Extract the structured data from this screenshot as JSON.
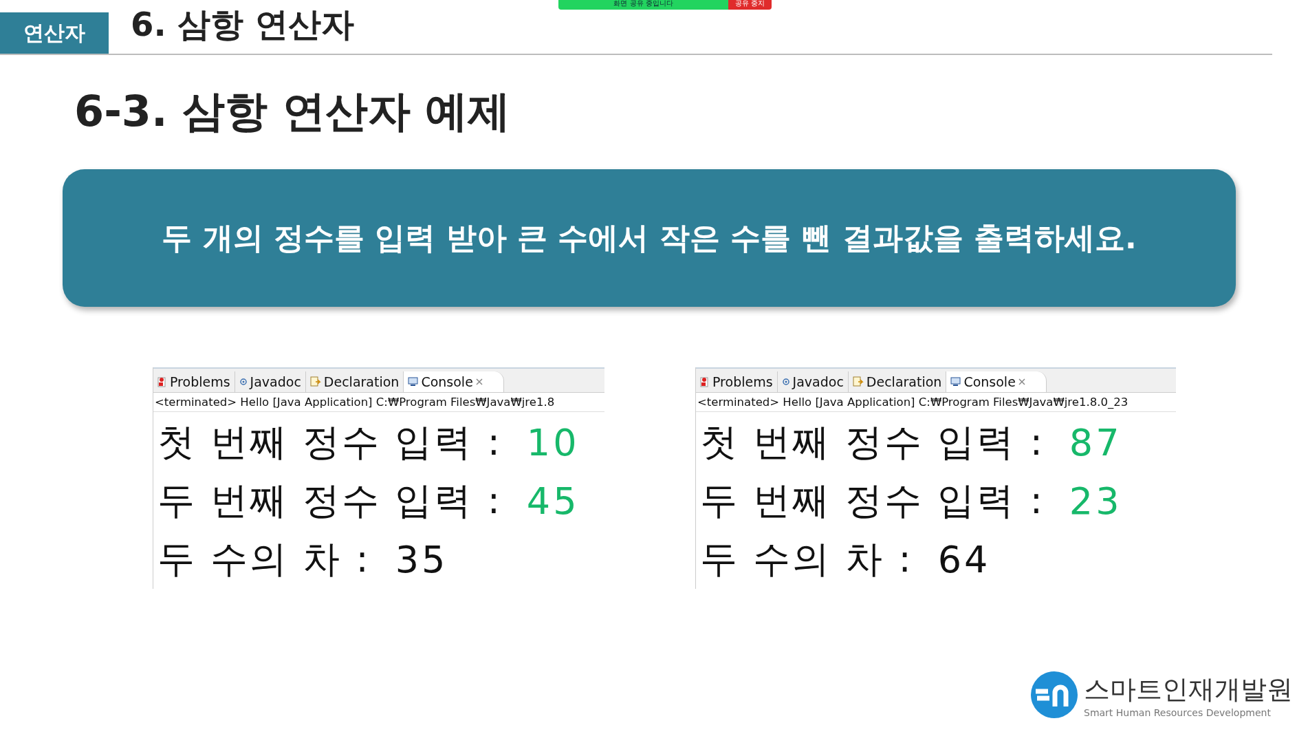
{
  "share_bar": {
    "status": "화면 공유 중입니다",
    "stop_button": "공유 중지"
  },
  "header": {
    "section_tag": "연산자",
    "title": "6. 삼항 연산자"
  },
  "subtitle": "6-3. 삼항 연산자 예제",
  "banner": "두 개의 정수를 입력 받아 큰 수에서 작은 수를 뺀 결과값을 출력하세요.",
  "consoles": [
    {
      "tabs": [
        {
          "label": "Problems",
          "selected": false
        },
        {
          "label": "Javadoc",
          "selected": false
        },
        {
          "label": "Declaration",
          "selected": false
        },
        {
          "label": "Console",
          "selected": true
        }
      ],
      "status": "<terminated> Hello [Java Application] C:₩Program Files₩Java₩jre1.8",
      "lines": [
        {
          "label": "첫 번째 정수 입력 :",
          "value": "10",
          "kind": "input"
        },
        {
          "label": "두 번째 정수 입력 :",
          "value": "45",
          "kind": "input"
        },
        {
          "label": "두 수의 차 :",
          "value": "35",
          "kind": "output"
        }
      ]
    },
    {
      "tabs": [
        {
          "label": "Problems",
          "selected": false
        },
        {
          "label": "Javadoc",
          "selected": false
        },
        {
          "label": "Declaration",
          "selected": false
        },
        {
          "label": "Console",
          "selected": true
        }
      ],
      "status": "<terminated> Hello [Java Application] C:₩Program Files₩Java₩jre1.8.0_23",
      "lines": [
        {
          "label": "첫 번째 정수 입력 :",
          "value": "87",
          "kind": "input"
        },
        {
          "label": "두 번째 정수 입력 :",
          "value": "23",
          "kind": "input"
        },
        {
          "label": "두 수의 차 :",
          "value": "64",
          "kind": "output"
        }
      ]
    }
  ],
  "logo": {
    "name": "스마트인재개발원",
    "tagline": "Smart Human Resources Development"
  }
}
